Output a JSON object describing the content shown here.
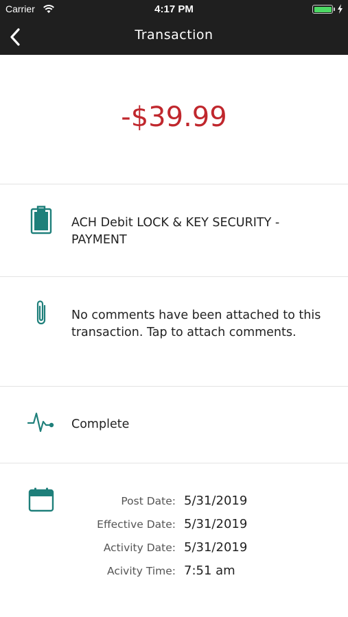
{
  "status_bar": {
    "carrier": "Carrier",
    "time": "4:17 PM",
    "battery_level": 1.0
  },
  "nav": {
    "title": "Transaction",
    "back_icon": "chevron-left-icon"
  },
  "transaction": {
    "amount": "-$39.99",
    "amount_color": "#c0272d",
    "description": "ACH Debit LOCK & KEY SECURITY - PAYMENT",
    "comments": "No comments have been attached to this transaction. Tap to attach comments.",
    "status": "Complete"
  },
  "dates": [
    {
      "label": "Post Date:",
      "value": "5/31/2019"
    },
    {
      "label": "Effective Date:",
      "value": "5/31/2019"
    },
    {
      "label": "Activity Date:",
      "value": "5/31/2019"
    },
    {
      "label": "Acivity Time:",
      "value": "7:51 am"
    }
  ],
  "colors": {
    "accent": "#1e7f7a",
    "topbar": "#1f1f1f",
    "negative": "#c0272d"
  },
  "icons": {
    "description": "clipboard-icon",
    "comments": "paperclip-icon",
    "status": "activity-pulse-icon",
    "dates": "calendar-icon"
  }
}
